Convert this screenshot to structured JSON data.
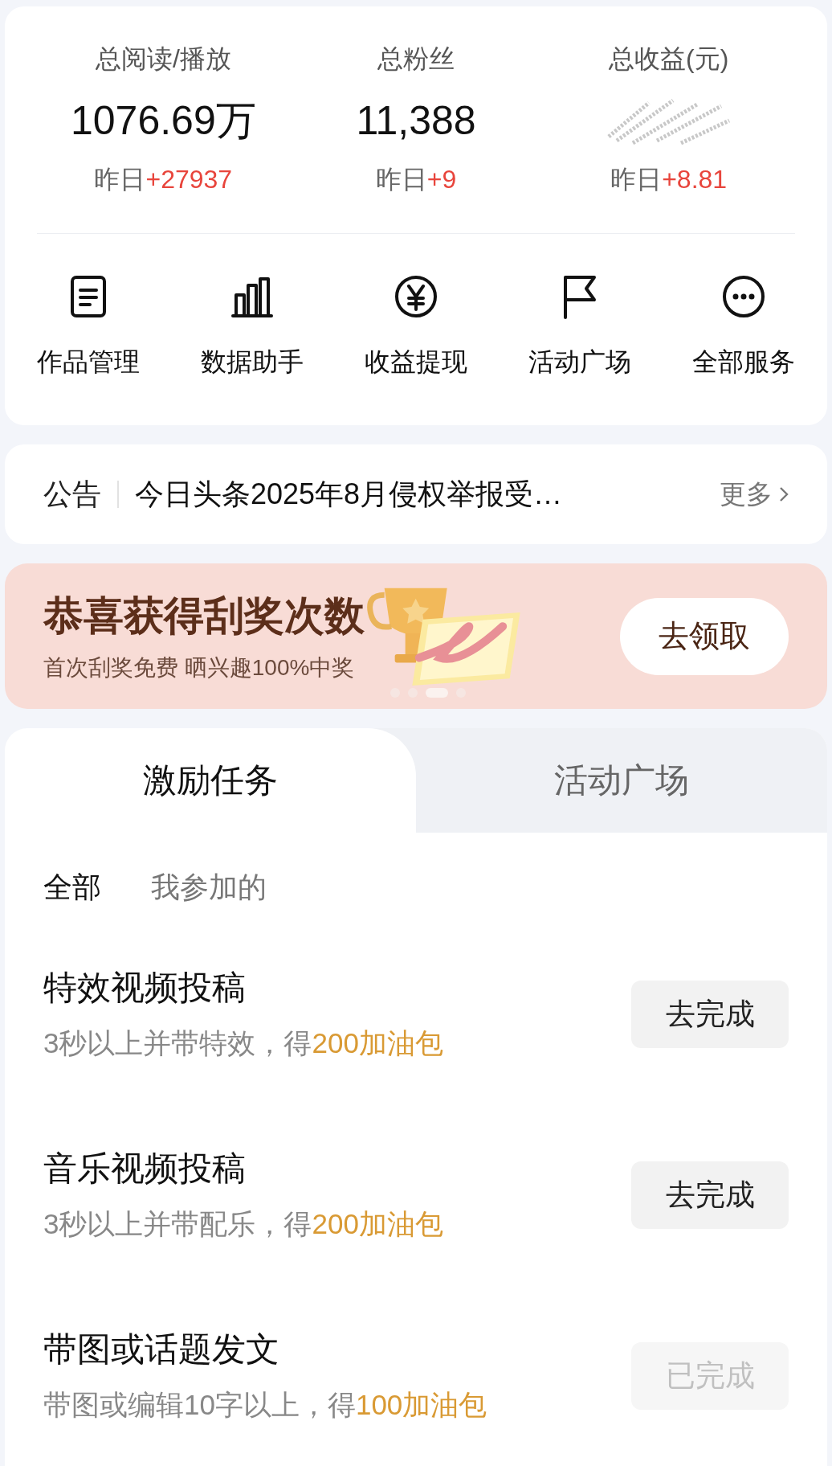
{
  "stats": [
    {
      "label": "总阅读/播放",
      "value": "1076.69万",
      "prefix": "昨日",
      "delta": "+27937",
      "obscured": false
    },
    {
      "label": "总粉丝",
      "value": "11,388",
      "prefix": "昨日",
      "delta": "+9",
      "obscured": false
    },
    {
      "label": "总收益(元)",
      "prefix": "昨日",
      "delta": "+8.81",
      "obscured": true
    }
  ],
  "services": [
    {
      "kind": "document",
      "label": "作品管理"
    },
    {
      "kind": "chart",
      "label": "数据助手"
    },
    {
      "kind": "yen",
      "label": "收益提现"
    },
    {
      "kind": "flag",
      "label": "活动广场"
    },
    {
      "kind": "more",
      "label": "全部服务"
    }
  ],
  "notice": {
    "tag": "公告",
    "text": "今日头条2025年8月侵权举报受…",
    "more": "更多"
  },
  "banner": {
    "title": "恭喜获得刮奖次数",
    "subtitle": "首次刮奖免费 晒兴趣100%中奖",
    "button": "去领取",
    "dots": [
      {
        "selected": false
      },
      {
        "selected": false
      },
      {
        "selected": true
      },
      {
        "selected": false
      }
    ]
  },
  "tabs": [
    {
      "label": "激励任务",
      "selected": true
    },
    {
      "label": "活动广场",
      "selected": false
    }
  ],
  "filters": [
    {
      "label": "全部",
      "selected": true
    },
    {
      "label": "我参加的",
      "selected": false
    }
  ],
  "tasks": [
    {
      "title": "特效视频投稿",
      "desc": "3秒以上并带特效，得",
      "reward": "200加油包",
      "button": "去完成",
      "done": false
    },
    {
      "title": "音乐视频投稿",
      "desc": "3秒以上并带配乐，得",
      "reward": "200加油包",
      "button": "去完成",
      "done": false
    },
    {
      "title": "带图或话题发文",
      "desc": "带图或编辑10字以上，得",
      "reward": "100加油包",
      "button": "已完成",
      "done": true
    }
  ]
}
